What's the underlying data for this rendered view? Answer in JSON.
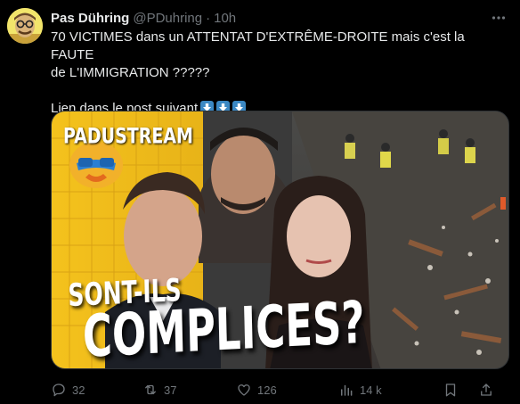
{
  "tweet": {
    "author_name": "Pas Dühring",
    "handle": "@PDuhring",
    "separator": "·",
    "time": "10h",
    "text_line1": "70 VICTIMES dans un ATTENTAT D'EXTRÊME-DROITE mais c'est la FAUTE",
    "text_line2": "de L'IMMIGRATION ?????",
    "text_line3": "Lien dans le post suivant",
    "link_emojis": [
      "arrow-down-emoji",
      "arrow-down-emoji",
      "arrow-down-emoji"
    ]
  },
  "media": {
    "brand": "PADUSTREAM",
    "overlay_line1": "SONT-ILS",
    "overlay_line2": "COMPLICES?"
  },
  "actions": {
    "replies": "32",
    "reposts": "37",
    "likes": "126",
    "views": "14 k"
  },
  "colors": {
    "background": "#000000",
    "text": "#e7e9ea",
    "muted": "#71767b",
    "emoji_blue": "#3b88c3",
    "avatar_yellow": "#f2e56b"
  }
}
